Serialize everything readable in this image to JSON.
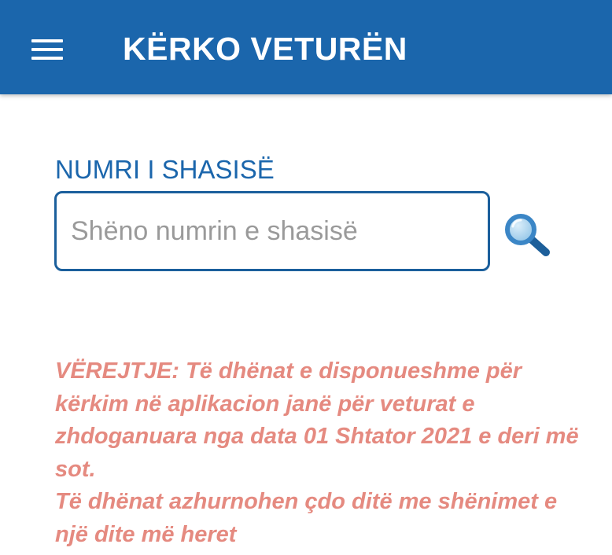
{
  "header": {
    "title": "KËRKO VETURËN"
  },
  "search": {
    "label": "NUMRI I SHASISË",
    "value": "",
    "placeholder": "Shëno numrin e shasisë"
  },
  "note": {
    "line1": "VËREJTJE: Të dhënat e disponueshme për kërkim në aplikacion janë për veturat e zhdoganuara nga data 01 Shtator 2021 e deri më sot.",
    "line2": "Të dhënat azhurnohen çdo ditë me shënimet e një dite më heret"
  },
  "icons": {
    "menu": "menu-icon",
    "search": "search-icon"
  },
  "colors": {
    "primary": "#1b66ac",
    "note": "#e58a80",
    "placeholder": "#9a9a9a"
  }
}
